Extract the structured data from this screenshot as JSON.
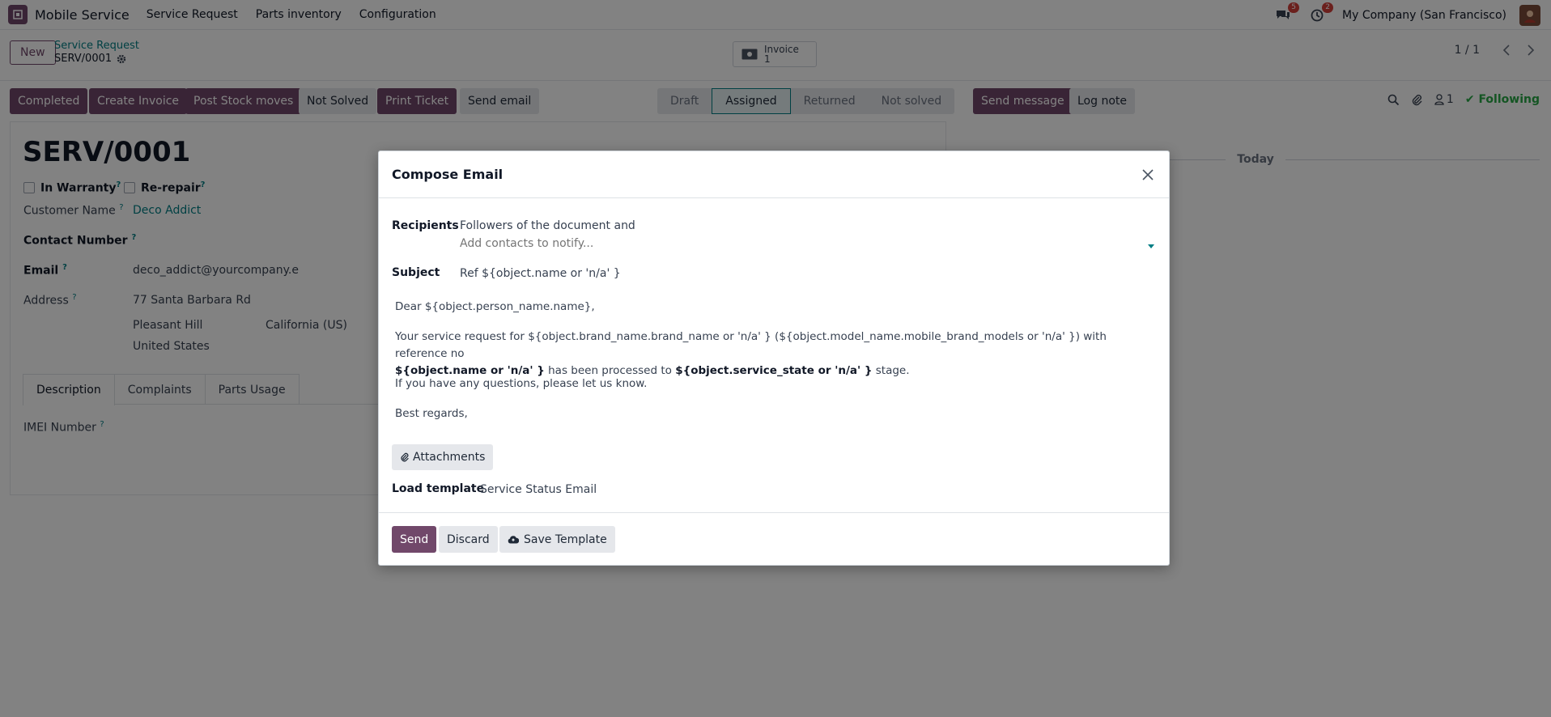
{
  "navbar": {
    "app_name": "Mobile Service",
    "menu": [
      "Service Request",
      "Parts inventory",
      "Configuration"
    ],
    "messages_badge": "5",
    "activities_badge": "2",
    "company": "My Company (San Francisco)"
  },
  "control_panel": {
    "new_label": "New",
    "breadcrumb_parent": "Service Request",
    "breadcrumb_current": "SERV/0001",
    "invoice_label": "Invoice",
    "invoice_count": "1",
    "pager": "1 / 1"
  },
  "actions": {
    "completed": "Completed",
    "create_invoice": "Create Invoice",
    "post_stock_moves": "Post Stock moves",
    "not_solved": "Not Solved",
    "print_ticket": "Print Ticket",
    "send_email": "Send email"
  },
  "stages": [
    "Draft",
    "Assigned",
    "Returned",
    "Not solved"
  ],
  "active_stage": "Assigned",
  "chatter": {
    "send_message": "Send message",
    "log_note": "Log note",
    "followers_count": "1",
    "following": "Following",
    "today": "Today"
  },
  "form": {
    "title": "SERV/0001",
    "in_warranty": "In Warranty",
    "re_repair": "Re-repair",
    "customer_name_label": "Customer Name",
    "customer_name": "Deco Addict",
    "contact_number_label": "Contact Number",
    "email_label": "Email",
    "email": "deco_addict@yourcompany.exar",
    "address_label": "Address",
    "street": "77 Santa Barbara Rd",
    "city": "Pleasant Hill",
    "state": "California (US)",
    "country": "United States",
    "tabs": [
      "Description",
      "Complaints",
      "Parts Usage"
    ],
    "imei_label": "IMEI Number",
    "help_mark": "?"
  },
  "modal": {
    "title": "Compose Email",
    "recipients_label": "Recipients",
    "recipients_text": "Followers of the document and",
    "recipients_placeholder": "Add contacts to notify...",
    "subject_label": "Subject",
    "subject_value": "Ref ${object.name or 'n/a' }",
    "body": {
      "greeting": "Dear ${object.person_name.name},",
      "p1_a": "Your service request for ${object.brand_name.brand_name or 'n/a' } (${object.model_name.mobile_brand_models or 'n/a' }) with reference no",
      "p1_b": "${object.name or 'n/a' }",
      "p1_c": " has been processed to ",
      "p1_d": "${object.service_state or 'n/a' }",
      "p1_e": " stage.",
      "p2": "If you have any questions, please let us know.",
      "p3": "Best regards,"
    },
    "attachments_label": "Attachments",
    "load_template_label": "Load template",
    "load_template_value": "Service Status Email",
    "send_label": "Send",
    "discard_label": "Discard",
    "save_template_label": "Save Template"
  },
  "colors": {
    "primary": "#71486a",
    "link": "#017e84",
    "following": "#28a745",
    "badge": "#d23f3a"
  }
}
